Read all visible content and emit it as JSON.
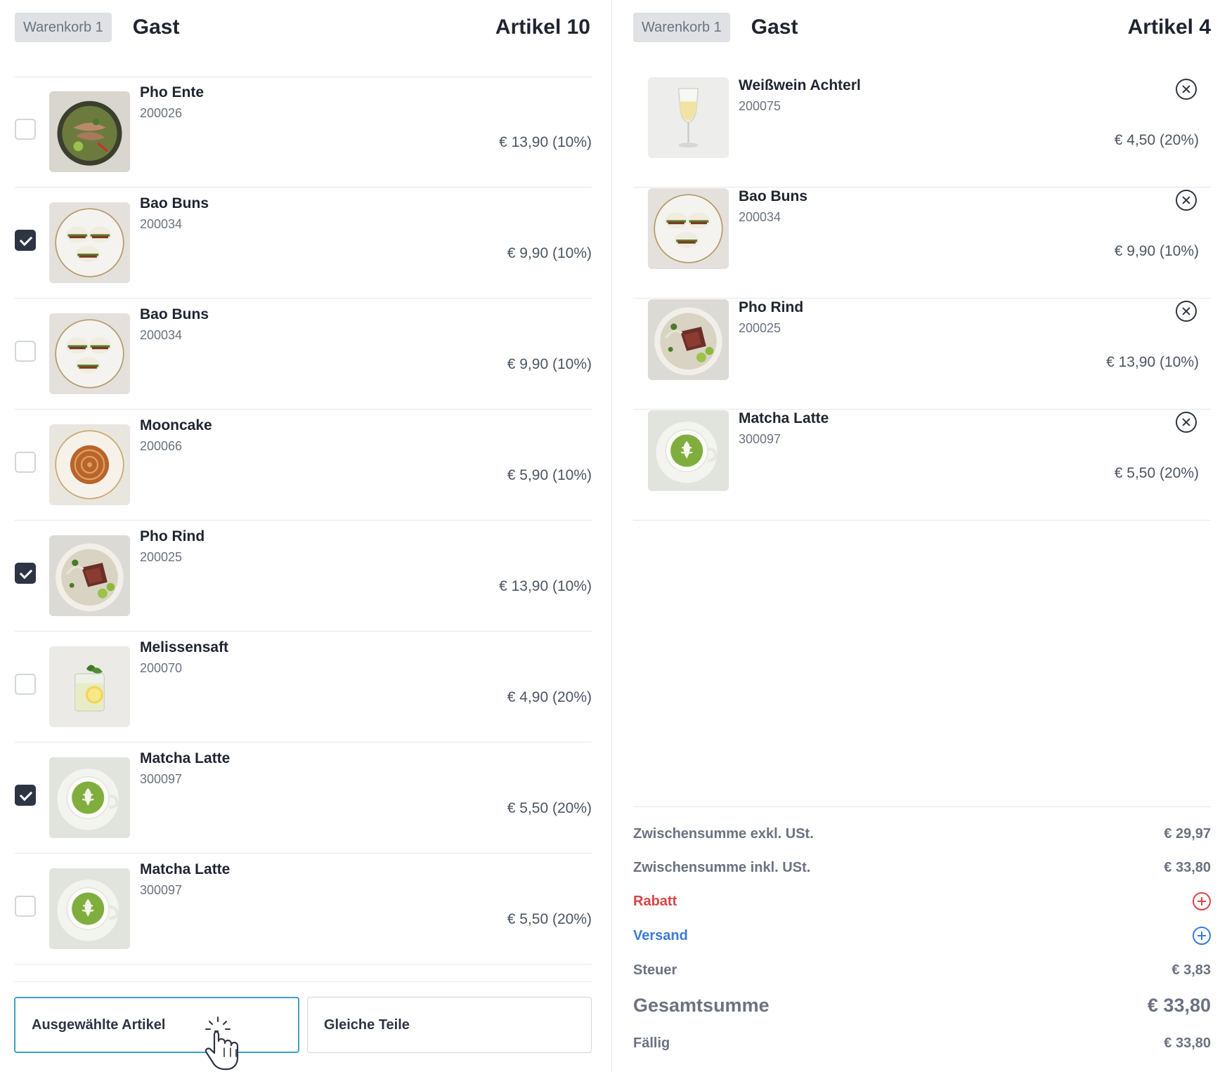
{
  "left_cart": {
    "badge": "Warenkorb 1",
    "guest": "Gast",
    "count": "Artikel 10",
    "items": [
      {
        "name": "Pho Ente",
        "sku": "200026",
        "price": "€ 13,90 (10%)",
        "checked": false,
        "image": "pho-duck"
      },
      {
        "name": "Bao Buns",
        "sku": "200034",
        "price": "€ 9,90 (10%)",
        "checked": true,
        "image": "bao-buns"
      },
      {
        "name": "Bao Buns",
        "sku": "200034",
        "price": "€ 9,90 (10%)",
        "checked": false,
        "image": "bao-buns"
      },
      {
        "name": "Mooncake",
        "sku": "200066",
        "price": "€ 5,90 (10%)",
        "checked": false,
        "image": "mooncake"
      },
      {
        "name": "Pho Rind",
        "sku": "200025",
        "price": "€ 13,90 (10%)",
        "checked": true,
        "image": "pho-beef"
      },
      {
        "name": "Melissensaft",
        "sku": "200070",
        "price": "€ 4,90 (20%)",
        "checked": false,
        "image": "lemon-drink"
      },
      {
        "name": "Matcha Latte",
        "sku": "300097",
        "price": "€ 5,50 (20%)",
        "checked": true,
        "image": "matcha"
      },
      {
        "name": "Matcha Latte",
        "sku": "300097",
        "price": "€ 5,50 (20%)",
        "checked": false,
        "image": "matcha"
      }
    ],
    "buttons": {
      "selected_items": "Ausgewählte Artikel",
      "equal_parts": "Gleiche Teile"
    }
  },
  "right_cart": {
    "badge": "Warenkorb 1",
    "guest": "Gast",
    "count": "Artikel 4",
    "items": [
      {
        "name": "Weißwein Achterl",
        "sku": "200075",
        "price": "€ 4,50 (20%)",
        "image": "wine"
      },
      {
        "name": "Bao Buns",
        "sku": "200034",
        "price": "€ 9,90 (10%)",
        "image": "bao-buns"
      },
      {
        "name": "Pho Rind",
        "sku": "200025",
        "price": "€ 13,90 (10%)",
        "image": "pho-beef"
      },
      {
        "name": "Matcha Latte",
        "sku": "300097",
        "price": "€ 5,50 (20%)",
        "image": "matcha"
      }
    ],
    "summary": {
      "subtotal_excl_label": "Zwischensumme exkl. USt.",
      "subtotal_excl_value": "€ 29,97",
      "subtotal_incl_label": "Zwischensumme inkl. USt.",
      "subtotal_incl_value": "€ 33,80",
      "discount_label": "Rabatt",
      "shipping_label": "Versand",
      "tax_label": "Steuer",
      "tax_value": "€ 3,83",
      "total_label": "Gesamtsumme",
      "total_value": "€ 33,80",
      "due_label": "Fällig",
      "due_value": "€ 33,80"
    }
  },
  "colors": {
    "accent_checked": "#2d3544",
    "selected_button_border": "#3ea3c4",
    "discount": "#d64545",
    "shipping": "#3a7bd5"
  }
}
